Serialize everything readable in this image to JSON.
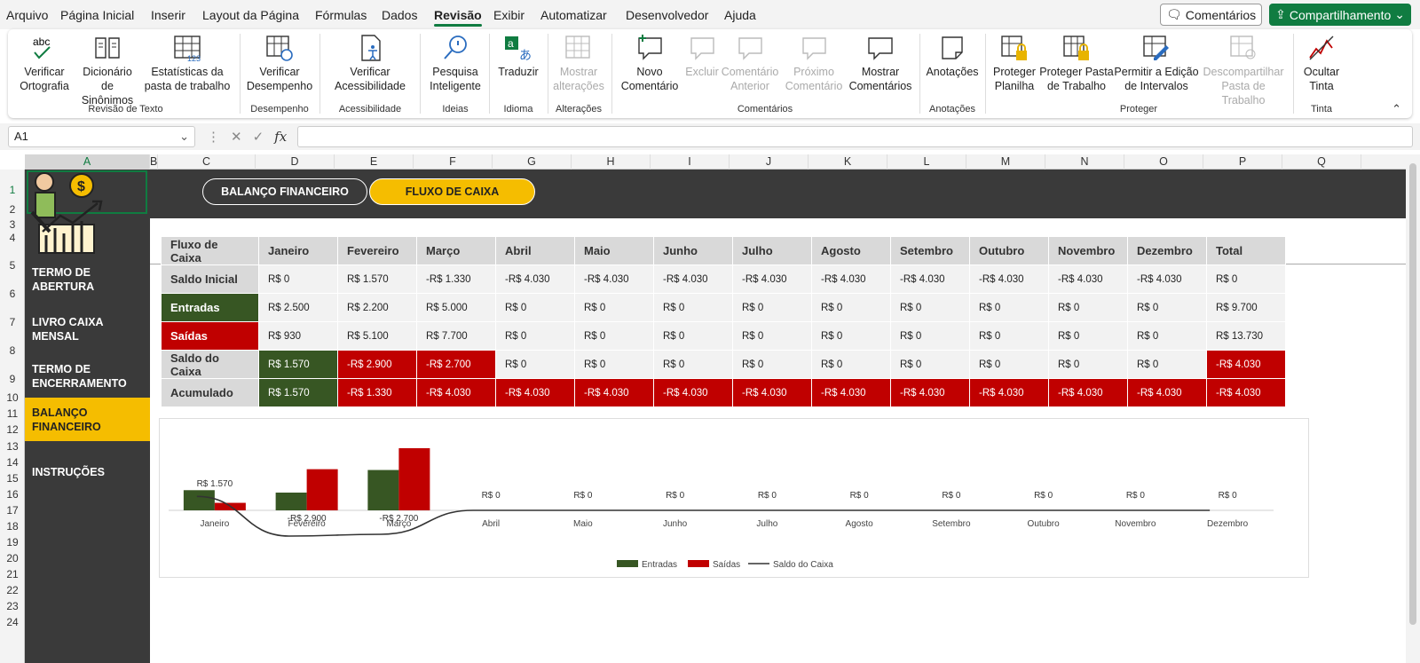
{
  "menu": [
    "Arquivo",
    "Página Inicial",
    "Inserir",
    "Layout da Página",
    "Fórmulas",
    "Dados",
    "Revisão",
    "Exibir",
    "Automatizar",
    "Desenvolvedor",
    "Ajuda"
  ],
  "menu_active": "Revisão",
  "top_right": {
    "comments": "Comentários",
    "share": "Compartilhamento"
  },
  "ribbon": {
    "spelling": "Verificar Ortografia",
    "thesaurus": "Dicionário de Sinônimos",
    "stats": "Estatísticas da pasta de trabalho",
    "group_text": "Revisão de Texto",
    "perf": "Verificar Desempenho",
    "group_perf": "Desempenho",
    "access": "Verificar Acessibilidade",
    "group_access": "Acessibilidade",
    "smart": "Pesquisa Inteligente",
    "group_ideas": "Ideias",
    "translate": "Traduzir",
    "group_lang": "Idioma",
    "show_changes": "Mostrar alterações",
    "group_changes": "Alterações",
    "new_comment": "Novo Comentário",
    "delete": "Excluir",
    "prev_comment": "Comentário Anterior",
    "next_comment": "Próximo Comentário",
    "show_comments": "Mostrar Comentários",
    "group_comments": "Comentários",
    "notes": "Anotações",
    "group_notes": "Anotações",
    "protect_sheet": "Proteger Planilha",
    "protect_wb": "Proteger Pasta de Trabalho",
    "allow_edit": "Permitir a Edição de Intervalos",
    "unshare": "Descompartilhar Pasta de Trabalho",
    "group_protect": "Proteger",
    "hide_ink": "Ocultar Tinta",
    "group_ink": "Tinta"
  },
  "namebox": "A1",
  "columns": [
    "A",
    "B",
    "C",
    "D",
    "E",
    "F",
    "G",
    "H",
    "I",
    "J",
    "K",
    "L",
    "M",
    "N",
    "O",
    "P",
    "Q"
  ],
  "rows": [
    "1",
    "2",
    "3",
    "4",
    "5",
    "6",
    "7",
    "8",
    "9",
    "10",
    "11",
    "12",
    "13",
    "14",
    "15",
    "16",
    "17",
    "18",
    "19",
    "20",
    "21",
    "22",
    "23",
    "24"
  ],
  "nav": [
    "TERMO DE ABERTURA",
    "LIVRO CAIXA MENSAL",
    "TERMO DE ENCERRAMENTO",
    "BALANÇO FINANCEIRO",
    "INSTRUÇÕES"
  ],
  "pills": {
    "balance": "BALANÇO FINANCEIRO",
    "cashflow": "FLUXO DE CAIXA"
  },
  "table": {
    "header": [
      "Fluxo de Caixa",
      "Janeiro",
      "Fevereiro",
      "Março",
      "Abril",
      "Maio",
      "Junho",
      "Julho",
      "Agosto",
      "Setembro",
      "Outubro",
      "Novembro",
      "Dezembro",
      "Total"
    ],
    "rows": [
      {
        "label": "Saldo Inicial",
        "values": [
          "R$ 0",
          "R$ 1.570",
          "-R$ 1.330",
          "-R$ 4.030",
          "-R$ 4.030",
          "-R$ 4.030",
          "-R$ 4.030",
          "-R$ 4.030",
          "-R$ 4.030",
          "-R$ 4.030",
          "-R$ 4.030",
          "-R$ 4.030",
          "R$ 0"
        ]
      },
      {
        "label": "Entradas",
        "values": [
          "R$ 2.500",
          "R$ 2.200",
          "R$ 5.000",
          "R$ 0",
          "R$ 0",
          "R$ 0",
          "R$ 0",
          "R$ 0",
          "R$ 0",
          "R$ 0",
          "R$ 0",
          "R$ 0",
          "R$ 9.700"
        ]
      },
      {
        "label": "Saídas",
        "values": [
          "R$ 930",
          "R$ 5.100",
          "R$ 7.700",
          "R$ 0",
          "R$ 0",
          "R$ 0",
          "R$ 0",
          "R$ 0",
          "R$ 0",
          "R$ 0",
          "R$ 0",
          "R$ 0",
          "R$ 13.730"
        ]
      },
      {
        "label": "Saldo do Caixa",
        "values": [
          "R$ 1.570",
          "-R$ 2.900",
          "-R$ 2.700",
          "R$ 0",
          "R$ 0",
          "R$ 0",
          "R$ 0",
          "R$ 0",
          "R$ 0",
          "R$ 0",
          "R$ 0",
          "R$ 0",
          "-R$ 4.030"
        ]
      },
      {
        "label": "Acumulado",
        "values": [
          "R$ 1.570",
          "-R$ 1.330",
          "-R$ 4.030",
          "-R$ 4.030",
          "-R$ 4.030",
          "-R$ 4.030",
          "-R$ 4.030",
          "-R$ 4.030",
          "-R$ 4.030",
          "-R$ 4.030",
          "-R$ 4.030",
          "-R$ 4.030",
          "-R$ 4.030"
        ]
      }
    ]
  },
  "chart_data": {
    "type": "bar",
    "categories": [
      "Janeiro",
      "Fevereiro",
      "Março",
      "Abril",
      "Maio",
      "Junho",
      "Julho",
      "Agosto",
      "Setembro",
      "Outubro",
      "Novembro",
      "Dezembro"
    ],
    "series": [
      {
        "name": "Entradas",
        "type": "bar",
        "color": "#375623",
        "values": [
          2500,
          2200,
          5000,
          0,
          0,
          0,
          0,
          0,
          0,
          0,
          0,
          0
        ]
      },
      {
        "name": "Saídas",
        "type": "bar",
        "color": "#c00000",
        "values": [
          930,
          5100,
          7700,
          0,
          0,
          0,
          0,
          0,
          0,
          0,
          0,
          0
        ]
      },
      {
        "name": "Saldo do Caixa",
        "type": "line",
        "color": "#333333",
        "values": [
          1570,
          -2900,
          -2700,
          0,
          0,
          0,
          0,
          0,
          0,
          0,
          0,
          0
        ]
      }
    ],
    "data_labels": [
      "R$ 1.570",
      "-R$ 2.900",
      "-R$ 2.700",
      "R$ 0",
      "R$ 0",
      "R$ 0",
      "R$ 0",
      "R$ 0",
      "R$ 0",
      "R$ 0",
      "R$ 0",
      "R$ 0"
    ],
    "legend": "bottom",
    "grid": false
  }
}
